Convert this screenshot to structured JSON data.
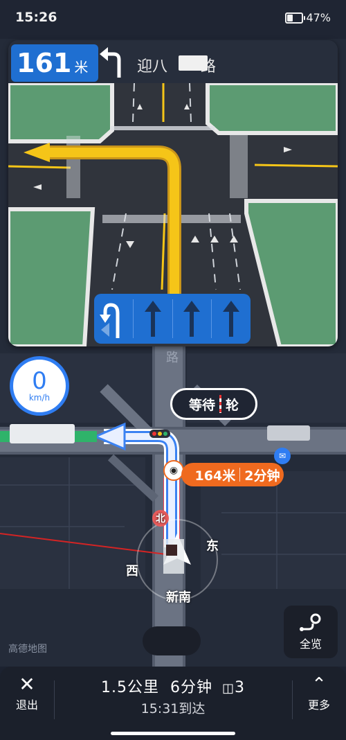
{
  "status": {
    "time": "15:26",
    "battery": "47%",
    "battery_level": 0.47
  },
  "guide": {
    "distance_value": "161",
    "distance_unit": "米",
    "turn_icon": "turn-left-icon",
    "road_name": "迎八",
    "road_suffix": "路"
  },
  "lanes": [
    {
      "icon": "left-uturn-lane-icon",
      "highlighted": true
    },
    {
      "icon": "straight-lane-icon",
      "highlighted": false
    },
    {
      "icon": "straight-lane-icon",
      "highlighted": false
    },
    {
      "icon": "straight-lane-icon",
      "highlighted": false
    }
  ],
  "map": {
    "road_label_vertical": "路",
    "road_label_bottom": "新南",
    "compass": {
      "north": "北",
      "east": "东",
      "west": "西"
    },
    "brand": "高德地图"
  },
  "speed": {
    "value": "0",
    "unit": "km/h"
  },
  "wait_bubble": {
    "left": "等待",
    "right": "轮"
  },
  "remaining_pill": {
    "distance": "164米",
    "time": "2分钟"
  },
  "overview_button": {
    "label": "全览"
  },
  "bottom_bar": {
    "exit_label": "退出",
    "more_label": "更多",
    "trip_distance": "1.5公里",
    "trip_time": "6分钟",
    "traffic_lights": "3",
    "arrival": "15:31到达"
  },
  "colors": {
    "accent_blue": "#1f6fd1",
    "route_orange": "#ef6a1f",
    "road_yellow": "#f5c518",
    "congestion_red": "#e8445a",
    "green_area": "#5c9b72"
  }
}
